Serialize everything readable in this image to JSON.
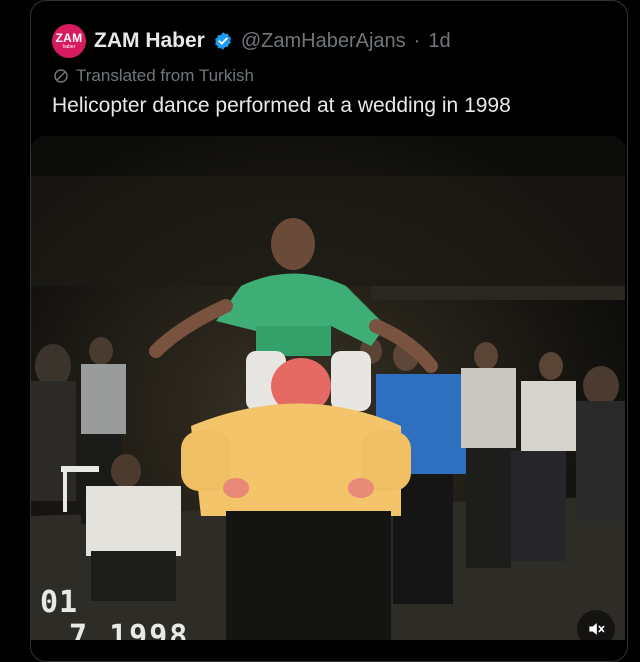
{
  "post": {
    "avatar_text": "ZAM",
    "avatar_subtext": "haber",
    "display_name": "ZAM Haber",
    "handle": "@ZamHaberAjans",
    "separator": "·",
    "time_ago": "1d",
    "translated_label": "Translated from Turkish",
    "text": "Helicopter dance performed at a wedding in 1998"
  },
  "video": {
    "date_line1": "01",
    "date_line2": "7  1998"
  },
  "colors": {
    "brand_avatar": "#d81b60",
    "verified": "#1d9bf0",
    "muted_text": "#71767b",
    "primary_text": "#e7e9ea"
  },
  "icons": {
    "verified": "verified-badge-icon",
    "translate": "translate-icon",
    "volume": "volume-icon"
  }
}
